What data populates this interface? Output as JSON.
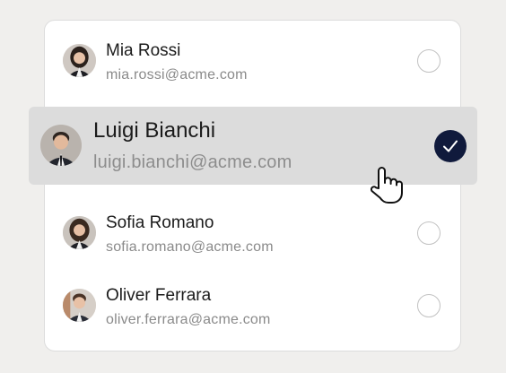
{
  "contacts": [
    {
      "name": "Mia Rossi",
      "email": "mia.rossi@acme.com",
      "selected": false
    },
    {
      "name": "Luigi Bianchi",
      "email": "luigi.bianchi@acme.com",
      "selected": true
    },
    {
      "name": "Sofia Romano",
      "email": "sofia.romano@acme.com",
      "selected": false
    },
    {
      "name": "Oliver Ferrara",
      "email": "oliver.ferrara@acme.com",
      "selected": false
    }
  ],
  "colors": {
    "selected_row": "#dcdcdc",
    "check_fill": "#101a3c",
    "radio_border": "#c2c2c2"
  },
  "icons": {
    "selected_indicator": "check-icon",
    "pointer": "hand-pointer-icon"
  }
}
